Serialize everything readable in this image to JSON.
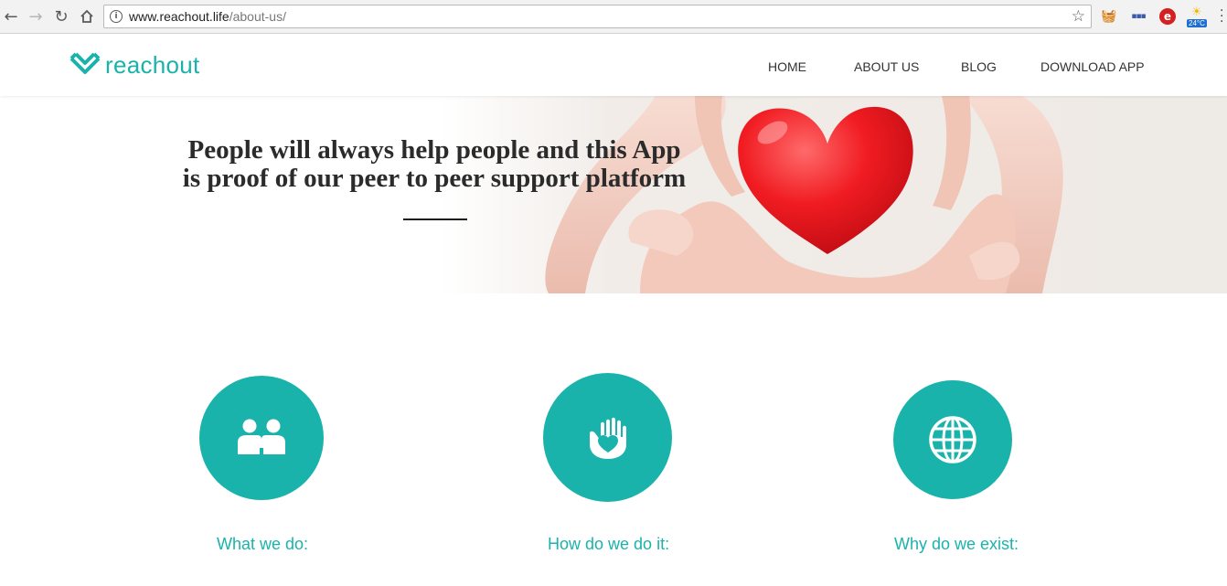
{
  "browser": {
    "url_domain": "www.reachout.life",
    "url_path": "/about-us/",
    "weather_temp": "24°C"
  },
  "site": {
    "logo_text": "reachout",
    "nav": [
      "HOME",
      "ABOUT US",
      "BLOG",
      "DOWNLOAD APP"
    ]
  },
  "hero": {
    "title_line1": "People will always help people and this App",
    "title_line2": "is proof of our peer to peer support platform"
  },
  "features": [
    {
      "label": "What we do:",
      "icon": "two-people-icon"
    },
    {
      "label": "How do we do it:",
      "icon": "hand-heart-icon"
    },
    {
      "label": "Why do we exist:",
      "icon": "globe-icon"
    }
  ],
  "colors": {
    "brand": "#1ab3ab",
    "heart": "#e8161c"
  }
}
